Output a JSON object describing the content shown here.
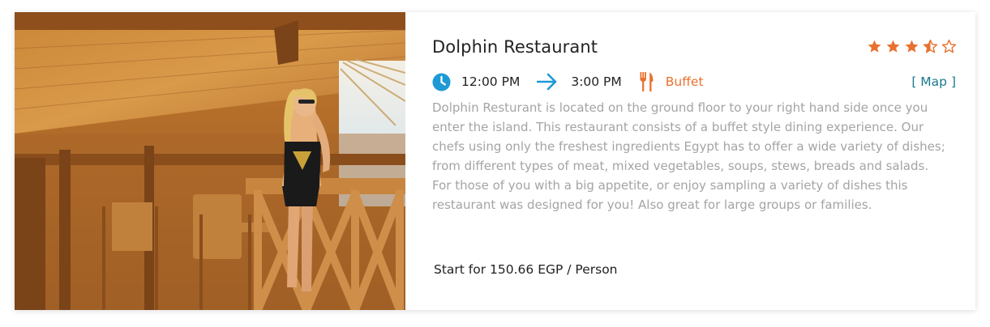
{
  "restaurant": {
    "name": "Dolphin Restaurant",
    "rating": 3.5,
    "rating_max": 5,
    "time_start": "12:00 PM",
    "time_end": "3:00 PM",
    "dining_type": "Buffet",
    "map_label": "[ Map ]",
    "description_p1": "Dolphin Resturant is located on the ground floor to your right hand side once you enter the island. This restaurant consists of a buffet style dining experience. Our chefs using only the freshest ingredients Egypt has to offer a wide variety of dishes; from different types of meat, mixed vegetables, soups, stews, breads and salads.",
    "description_p2": "For those of you with a big appetite, or enjoy sampling a variety of dishes this restaurant was designed for you! Also great for large groups or families.",
    "price_text": "Start for 150.66 EGP / Person"
  },
  "icons": {
    "clock": "clock-icon",
    "arrow": "arrow-right-icon",
    "dining": "fork-knife-icon",
    "star": "star-icon"
  },
  "colors": {
    "accent_orange": "#e8712f",
    "accent_blue": "#1e9ad6",
    "link_teal": "#1a7a8c",
    "text_dark": "#222222",
    "text_muted": "#a4a4a4"
  }
}
